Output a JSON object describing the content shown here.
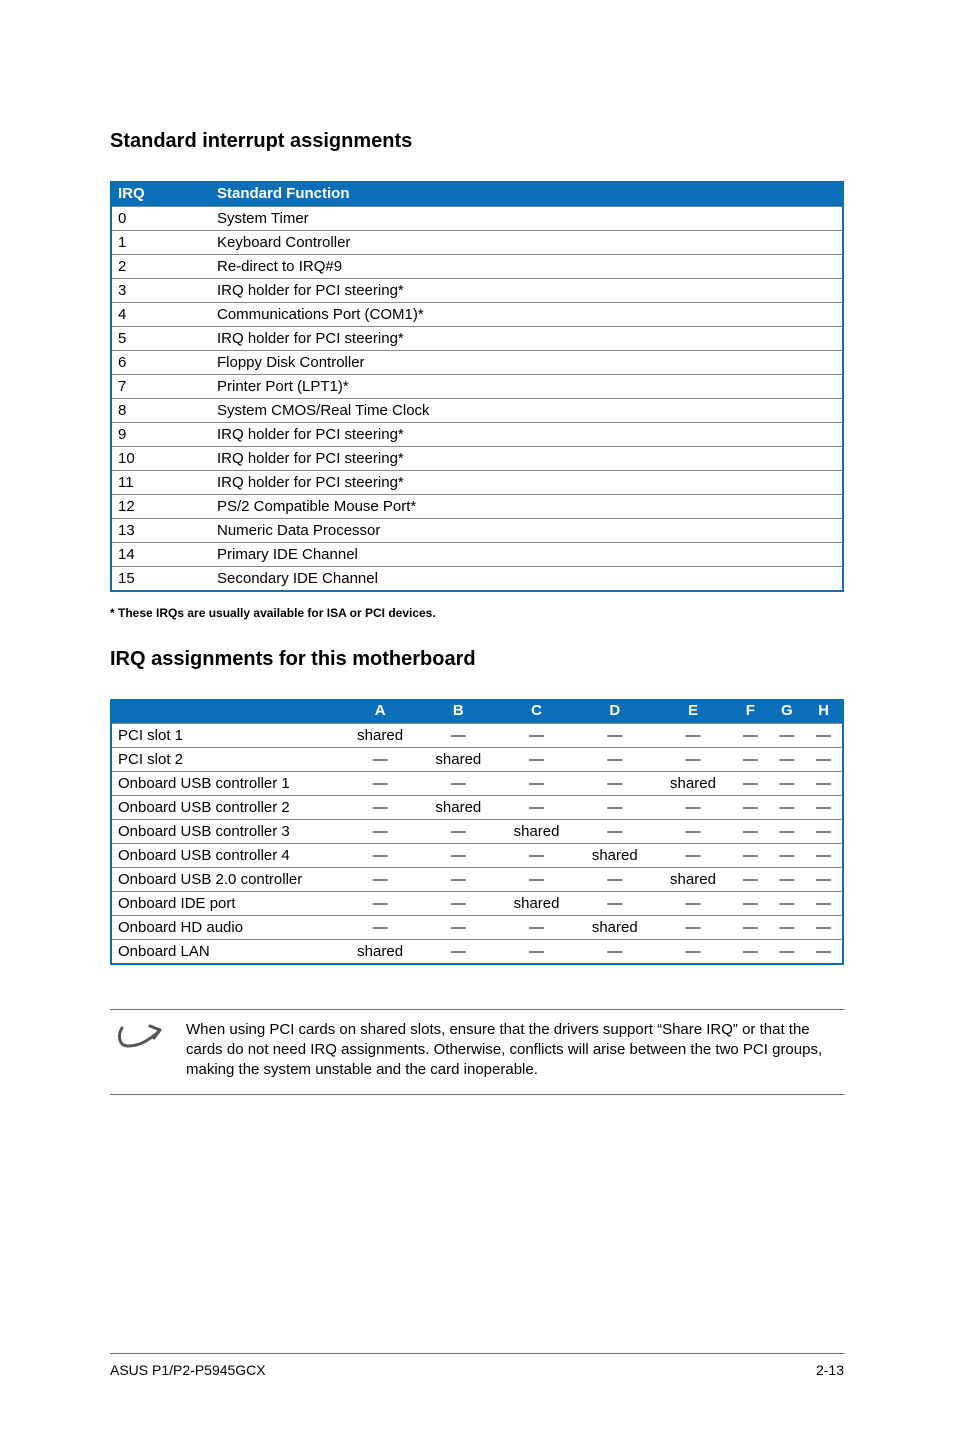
{
  "headings": {
    "standard": "Standard interrupt assignments",
    "assignments": "IRQ assignments for this motherboard"
  },
  "irq_table": {
    "headers": {
      "irq": "IRQ",
      "func": "Standard Function"
    },
    "rows": [
      {
        "irq": "0",
        "func": "System Timer"
      },
      {
        "irq": "1",
        "func": "Keyboard Controller"
      },
      {
        "irq": "2",
        "func": "Re-direct to IRQ#9"
      },
      {
        "irq": "3",
        "func": "IRQ holder for PCI steering*"
      },
      {
        "irq": "4",
        "func": "Communications Port (COM1)*"
      },
      {
        "irq": "5",
        "func": "IRQ holder for PCI steering*"
      },
      {
        "irq": "6",
        "func": "Floppy Disk Controller"
      },
      {
        "irq": "7",
        "func": "Printer Port (LPT1)*"
      },
      {
        "irq": "8",
        "func": "System CMOS/Real Time Clock"
      },
      {
        "irq": "9",
        "func": "IRQ holder for PCI steering*"
      },
      {
        "irq": "10",
        "func": "IRQ holder for PCI steering*"
      },
      {
        "irq": "11",
        "func": "IRQ holder for PCI steering*"
      },
      {
        "irq": "12",
        "func": "PS/2 Compatible Mouse Port*"
      },
      {
        "irq": "13",
        "func": "Numeric Data Processor"
      },
      {
        "irq": "14",
        "func": "Primary IDE Channel"
      },
      {
        "irq": "15",
        "func": "Secondary IDE Channel"
      }
    ]
  },
  "footnote": "* These IRQs are usually available for ISA or PCI devices.",
  "assign_table": {
    "headers": [
      "A",
      "B",
      "C",
      "D",
      "E",
      "F",
      "G",
      "H"
    ],
    "rows": [
      {
        "label": "PCI slot 1",
        "cells": [
          "shared",
          "—",
          "—",
          "—",
          "—",
          "—",
          "—",
          "—"
        ]
      },
      {
        "label": "PCI slot 2",
        "cells": [
          "—",
          "shared",
          "—",
          "—",
          "—",
          "—",
          "—",
          "—"
        ]
      },
      {
        "label": "Onboard USB controller 1",
        "cells": [
          "—",
          "—",
          "—",
          "—",
          "shared",
          "—",
          "—",
          "—"
        ]
      },
      {
        "label": "Onboard USB controller 2",
        "cells": [
          "—",
          "shared",
          "—",
          "—",
          "—",
          "—",
          "—",
          "—"
        ]
      },
      {
        "label": "Onboard USB controller 3",
        "cells": [
          "—",
          "—",
          "shared",
          "—",
          "—",
          "—",
          "—",
          "—"
        ]
      },
      {
        "label": "Onboard USB controller 4",
        "cells": [
          "—",
          "—",
          "—",
          "shared",
          "—",
          "—",
          "—",
          "—"
        ]
      },
      {
        "label": "Onboard USB 2.0 controller",
        "cells": [
          "—",
          "—",
          "—",
          "—",
          "shared",
          "—",
          "—",
          "—"
        ]
      },
      {
        "label": "Onboard IDE port",
        "cells": [
          "—",
          "—",
          "shared",
          "—",
          "—",
          "—",
          "—",
          "—"
        ]
      },
      {
        "label": "Onboard HD audio",
        "cells": [
          "—",
          "—",
          "—",
          "shared",
          "—",
          "—",
          "—",
          "—"
        ]
      },
      {
        "label": "Onboard LAN",
        "cells": [
          "shared",
          "—",
          "—",
          "—",
          "—",
          "—",
          "—",
          "—"
        ]
      }
    ]
  },
  "note": "When using PCI cards on shared slots, ensure that the drivers support “Share IRQ” or that the cards do not need IRQ assignments. Otherwise, conflicts will arise between the two PCI groups, making the system unstable and the card inoperable.",
  "footer": {
    "left": "ASUS P1/P2-P5945GCX",
    "right": "2-13"
  }
}
